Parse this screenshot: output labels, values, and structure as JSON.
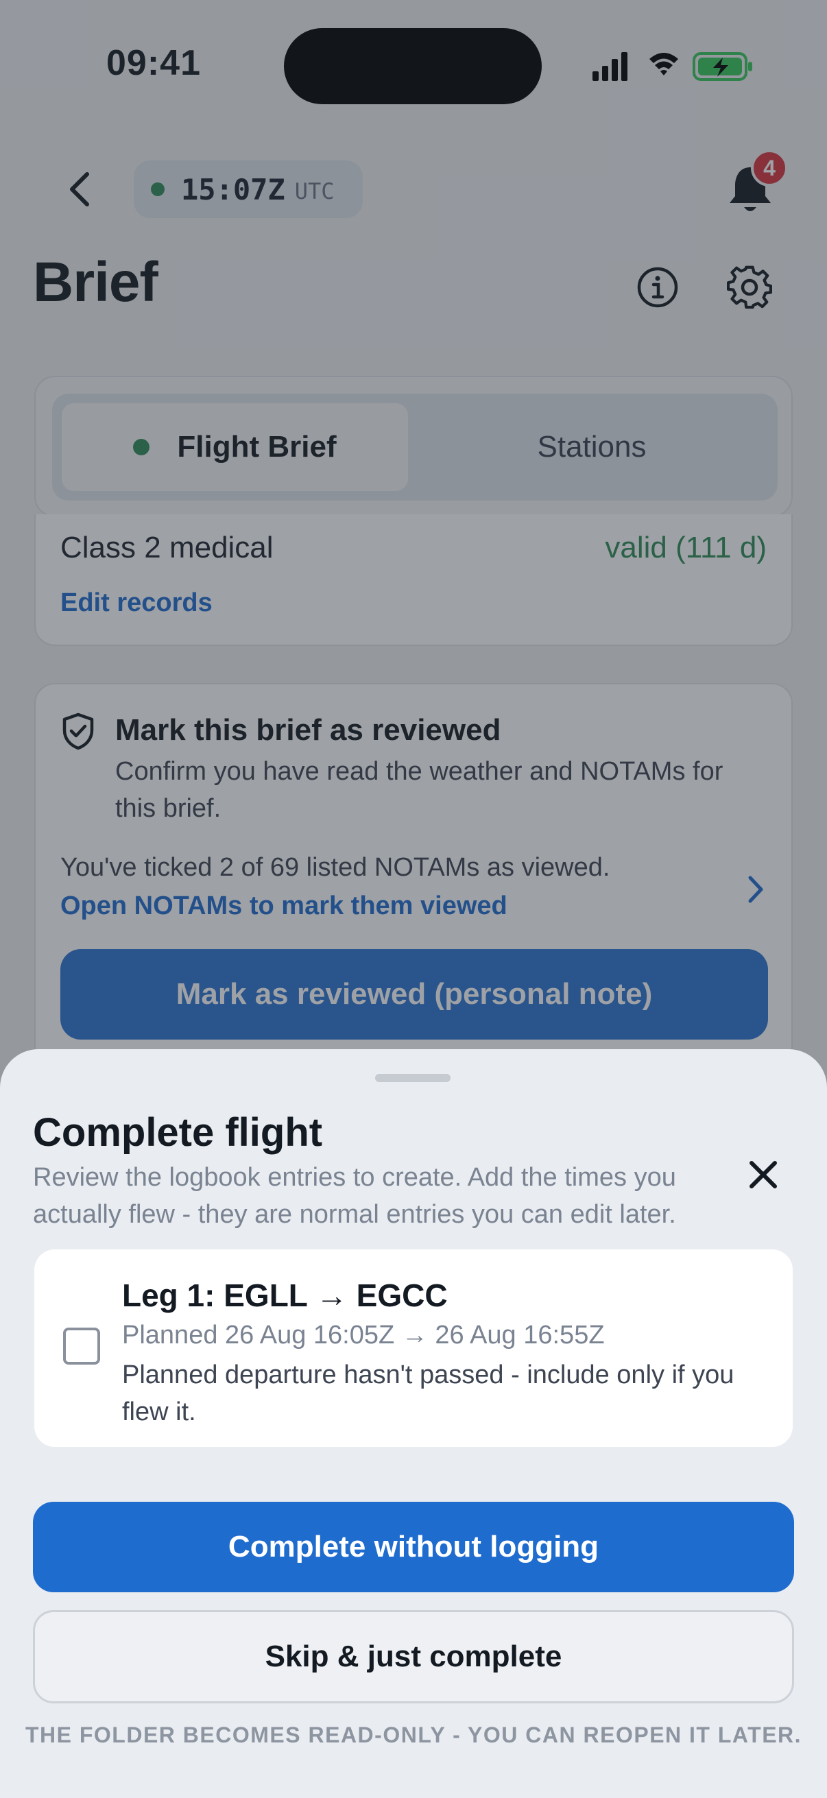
{
  "status_bar": {
    "time": "09:41",
    "icons": [
      "signal-icon",
      "wifi-icon",
      "battery-charging-icon"
    ],
    "battery_color": "#34c759"
  },
  "header": {
    "utc_time": "15:07Z",
    "utc_label": "UTC",
    "notification_count": "4",
    "page_title": "Brief"
  },
  "tabs": {
    "items": [
      {
        "label": "Flight Brief",
        "selected": true
      },
      {
        "label": "Stations",
        "selected": false
      }
    ]
  },
  "medical": {
    "label": "Class 2 medical",
    "value": "valid (111 d)",
    "edit_link": "Edit records"
  },
  "review": {
    "title": "Mark this brief as reviewed",
    "description": "Confirm you have read the weather and NOTAMs for this brief.",
    "count_text": "You've ticked 2 of 69 listed NOTAMs as viewed.",
    "open_link": "Open NOTAMs to mark them viewed",
    "button_label": "Mark as reviewed (personal note)"
  },
  "sheet": {
    "title": "Complete flight",
    "description": "Review the logbook entries to create. Add the times you actually flew - they are normal entries you can edit later.",
    "legs": [
      {
        "title": "Leg 1: EGLL → EGCC",
        "planned": "Planned 26 Aug 16:05Z → 26 Aug 16:55Z",
        "note": "Planned departure hasn't passed - include only if you flew it.",
        "checked": false
      }
    ],
    "primary_button": "Complete without logging",
    "secondary_button": "Skip & just complete",
    "footnote": "THE FOLDER BECOMES READ-ONLY - YOU CAN REOPEN IT LATER."
  },
  "colors": {
    "accent": "#1f6ccf",
    "success": "#2e8b57",
    "badge": "#d8333c"
  }
}
